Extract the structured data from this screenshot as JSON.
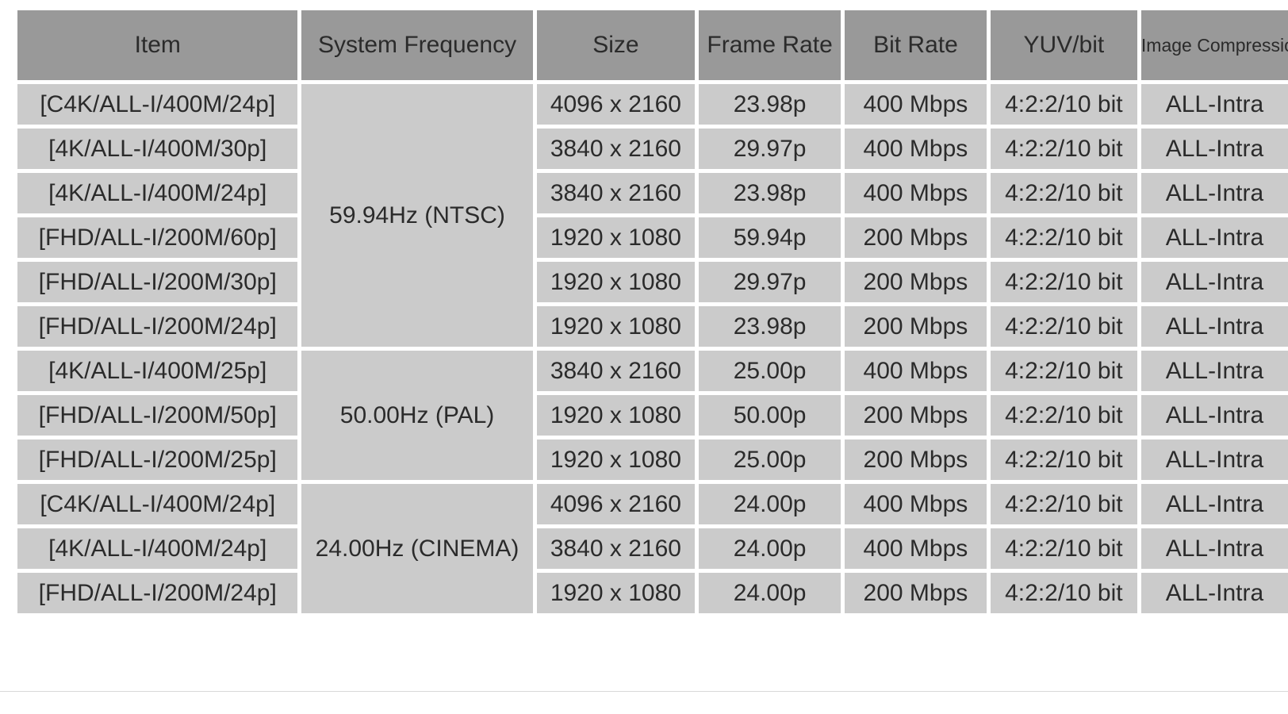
{
  "table": {
    "headers": [
      "Item",
      "System Frequency",
      "Size",
      "Frame Rate",
      "Bit Rate",
      "YUV/bit",
      "Image Compression"
    ],
    "groups": [
      {
        "frequency": "59.94Hz (NTSC)",
        "rows": [
          {
            "item": "[C4K/ALL-I/400M/24p]",
            "size": "4096 x 2160",
            "frame_rate": "23.98p",
            "bit_rate": "400 Mbps",
            "yuv_bit": "4:2:2/10 bit",
            "image_compression": "ALL-Intra"
          },
          {
            "item": "[4K/ALL-I/400M/30p]",
            "size": "3840 x 2160",
            "frame_rate": "29.97p",
            "bit_rate": "400 Mbps",
            "yuv_bit": "4:2:2/10 bit",
            "image_compression": "ALL-Intra"
          },
          {
            "item": "[4K/ALL-I/400M/24p]",
            "size": "3840 x 2160",
            "frame_rate": "23.98p",
            "bit_rate": "400 Mbps",
            "yuv_bit": "4:2:2/10 bit",
            "image_compression": "ALL-Intra"
          },
          {
            "item": "[FHD/ALL-I/200M/60p]",
            "size": "1920 x 1080",
            "frame_rate": "59.94p",
            "bit_rate": "200 Mbps",
            "yuv_bit": "4:2:2/10 bit",
            "image_compression": "ALL-Intra"
          },
          {
            "item": "[FHD/ALL-I/200M/30p]",
            "size": "1920 x 1080",
            "frame_rate": "29.97p",
            "bit_rate": "200 Mbps",
            "yuv_bit": "4:2:2/10 bit",
            "image_compression": "ALL-Intra"
          },
          {
            "item": "[FHD/ALL-I/200M/24p]",
            "size": "1920 x 1080",
            "frame_rate": "23.98p",
            "bit_rate": "200 Mbps",
            "yuv_bit": "4:2:2/10 bit",
            "image_compression": "ALL-Intra"
          }
        ]
      },
      {
        "frequency": "50.00Hz (PAL)",
        "rows": [
          {
            "item": "[4K/ALL-I/400M/25p]",
            "size": "3840 x 2160",
            "frame_rate": "25.00p",
            "bit_rate": "400 Mbps",
            "yuv_bit": "4:2:2/10 bit",
            "image_compression": "ALL-Intra"
          },
          {
            "item": "[FHD/ALL-I/200M/50p]",
            "size": "1920 x 1080",
            "frame_rate": "50.00p",
            "bit_rate": "200 Mbps",
            "yuv_bit": "4:2:2/10 bit",
            "image_compression": "ALL-Intra"
          },
          {
            "item": "[FHD/ALL-I/200M/25p]",
            "size": "1920 x 1080",
            "frame_rate": "25.00p",
            "bit_rate": "200 Mbps",
            "yuv_bit": "4:2:2/10 bit",
            "image_compression": "ALL-Intra"
          }
        ]
      },
      {
        "frequency": "24.00Hz (CINEMA)",
        "rows": [
          {
            "item": "[C4K/ALL-I/400M/24p]",
            "size": "4096 x 2160",
            "frame_rate": "24.00p",
            "bit_rate": "400 Mbps",
            "yuv_bit": "4:2:2/10 bit",
            "image_compression": "ALL-Intra"
          },
          {
            "item": "[4K/ALL-I/400M/24p]",
            "size": "3840 x 2160",
            "frame_rate": "24.00p",
            "bit_rate": "400 Mbps",
            "yuv_bit": "4:2:2/10 bit",
            "image_compression": "ALL-Intra"
          },
          {
            "item": "[FHD/ALL-I/200M/24p]",
            "size": "1920 x 1080",
            "frame_rate": "24.00p",
            "bit_rate": "200 Mbps",
            "yuv_bit": "4:2:2/10 bit",
            "image_compression": "ALL-Intra"
          }
        ]
      }
    ]
  },
  "colors": {
    "header_background": "#999999",
    "cell_background": "#cbcbcb",
    "page_background": "#ffffff",
    "text": "#2b2b2b"
  }
}
